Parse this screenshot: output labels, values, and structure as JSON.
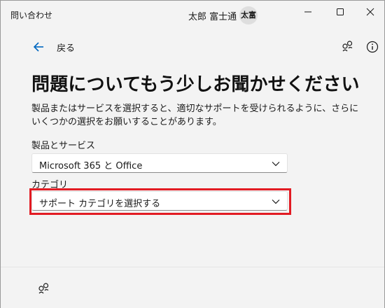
{
  "titlebar": {
    "app_title": "問い合わせ",
    "user_name": "太郎 富士通",
    "avatar_initials": "太富",
    "minimize_icon": "minimize-icon",
    "maximize_icon": "maximize-icon",
    "close_icon": "close-icon"
  },
  "nav": {
    "back_label": "戻る",
    "back_icon": "arrow-left-icon",
    "share_icon": "share-icon",
    "info_icon": "info-icon"
  },
  "content": {
    "heading": "問題についてもう少しお聞かせください",
    "description": "製品またはサービスを選択すると、適切なサポートを受けられるように、さらにいくつかの選択をお願いすることがあります。",
    "product_label": "製品とサービス",
    "product_value": "Microsoft 365 と Office",
    "category_label": "カテゴリ",
    "category_value": "サポート カテゴリを選択する"
  },
  "colors": {
    "accent": "#0067c0",
    "highlight": "#e21b23",
    "background": "#f3f3f3"
  }
}
